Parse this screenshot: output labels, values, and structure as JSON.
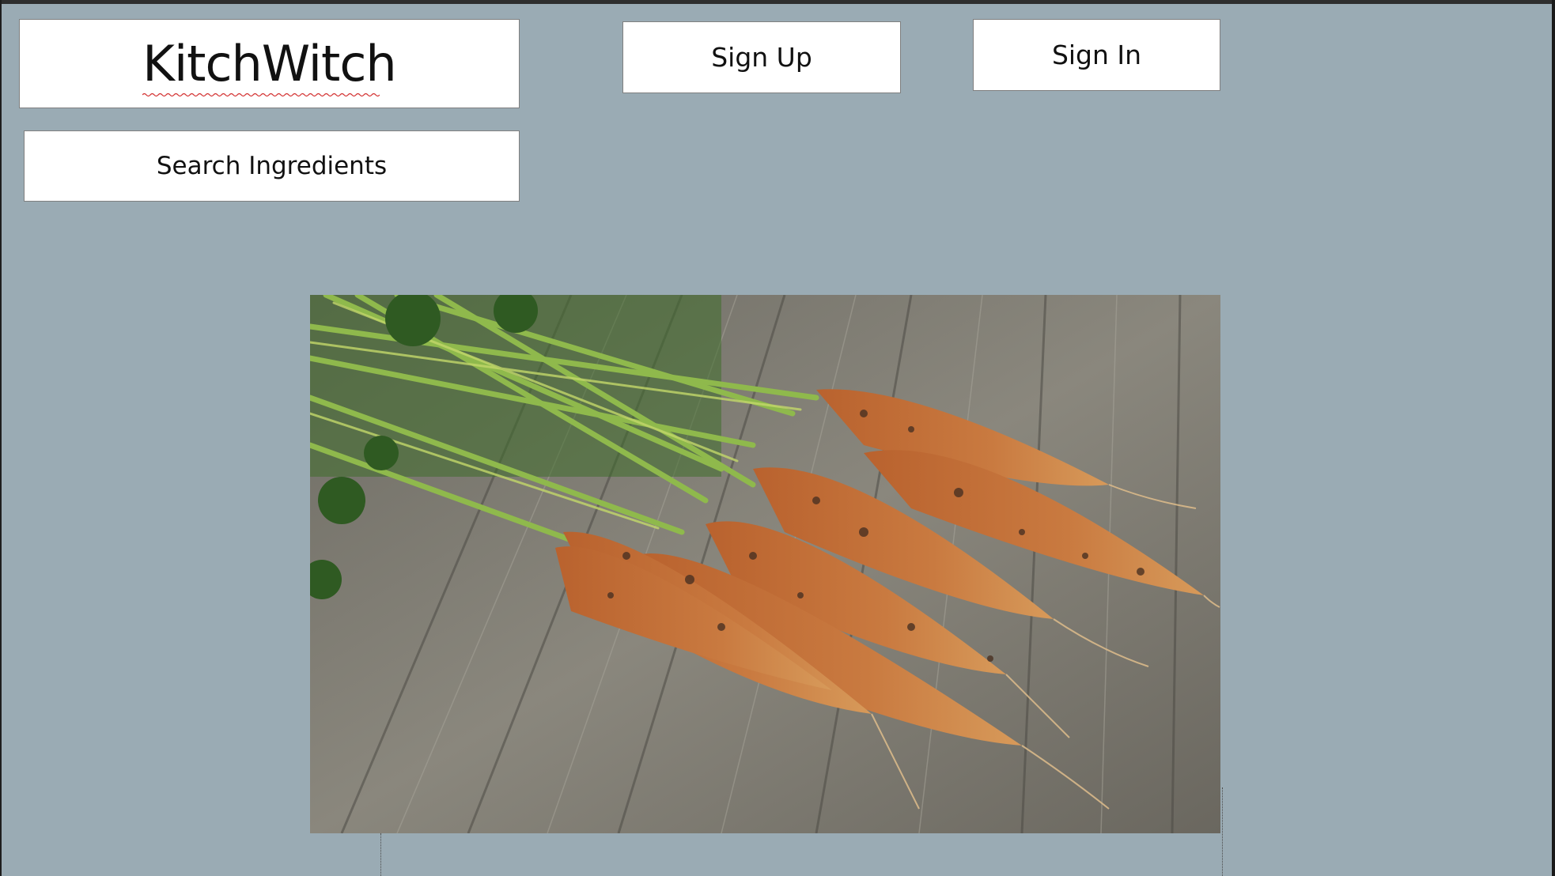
{
  "header": {
    "logo_text": "KitchWitch",
    "signup_label": "Sign Up",
    "signin_label": "Sign In"
  },
  "search": {
    "button_label": "Search Ingredients"
  },
  "hero": {
    "image_subject": "carrots-photo"
  },
  "colors": {
    "background": "#9aabb4",
    "box_fill": "#ffffff",
    "box_border": "#7f7f7f",
    "spellcheck_underline": "#d33030"
  }
}
